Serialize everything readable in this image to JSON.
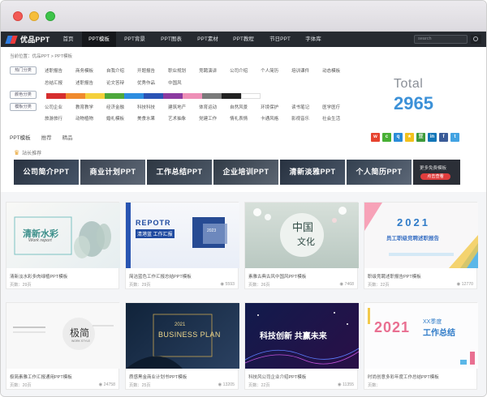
{
  "nav": {
    "logo": "优品PPT",
    "items": [
      "首页",
      "PPT模板",
      "PPT背景",
      "PPT图表",
      "PPT素材",
      "PPT教程",
      "节日PPT",
      "字体库"
    ],
    "search_placeholder": "search"
  },
  "breadcrumb": "当前位置：优品PPT > PPT模板",
  "filters": {
    "hot_label": "热门分类",
    "hot_row1": [
      "述职报告",
      "商务模板",
      "自我介绍",
      "开题报告",
      "职业规划",
      "竞聘演讲",
      "公司介绍",
      "个人简历",
      "培训课件",
      "动态模板"
    ],
    "hot_row2": [
      "总结汇报",
      "述职报告",
      "论文答辩",
      "优秀作品",
      "中国风"
    ],
    "color_label": "颜色分类",
    "colors": [
      "#d62e2e",
      "#f08a2d",
      "#f4d03b",
      "#4ea83c",
      "#2d8de0",
      "#2a53b5",
      "#8b3aa0",
      "#ee8fb7",
      "#7a7a7a",
      "#222222",
      "#ffffff"
    ],
    "template_label": "模板分类",
    "template_row1": [
      "公司企业",
      "教育教学",
      "经济金融",
      "科技科技",
      "建筑地产",
      "体育运动",
      "自然风景",
      "环境保护",
      "读书笔记",
      "医学医疗"
    ],
    "template_row2": [
      "旅游旅行",
      "动物植物",
      "婚礼模板",
      "美食水果",
      "艺术抽象",
      "党建工作",
      "情礼表情",
      "卡通风格",
      "影视音乐",
      "社会生活"
    ]
  },
  "total": {
    "label": "Total",
    "count": "2965"
  },
  "tabs": [
    "PPT模板",
    "推荐",
    "精品"
  ],
  "social_icons": [
    "weibo-icon",
    "wechat-icon",
    "qzone-icon",
    "star-icon",
    "douban-icon",
    "linkedin-icon",
    "facebook-icon",
    "twitter-icon"
  ],
  "recommend": {
    "title": "站长推荐",
    "banners": [
      "公司简介PPT",
      "商业计划PPT",
      "工作总结PPT",
      "企业培训PPT",
      "清新淡雅PPT",
      "个人简历PPT"
    ],
    "more_text": "更多免费模板",
    "more_button": "点击查看"
  },
  "cards": [
    {
      "title": "清新淡水彩多肉绿植PPT模板",
      "pages": "页数：29页",
      "views": "",
      "thumb_text": [
        "清新水彩",
        "Work report"
      ]
    },
    {
      "title": "简洁蓝色工作汇报总结PPT模板",
      "pages": "页数：29页",
      "views": "5593",
      "thumb_text": [
        "REPOTR",
        "清港蓝 工作汇报",
        "2023"
      ]
    },
    {
      "title": "素雅古典古风中国风PPT模板",
      "pages": "页数：26页",
      "views": "7468",
      "thumb_text": [
        "中国",
        "文化"
      ]
    },
    {
      "title": "职级竞聘述职报告PPT模板",
      "pages": "页数：22页",
      "views": "12770",
      "thumb_text": [
        "2021",
        "员工职级竞聘述职报告"
      ]
    },
    {
      "title": "极简素雅工作汇报通用PPT模板",
      "pages": "页数：20页",
      "views": "24758",
      "thumb_text": [
        "极简",
        "WORK STYLE"
      ]
    },
    {
      "title": "质感黑金商业计划书PPT模板",
      "pages": "页数：25页",
      "views": "13205",
      "thumb_text": [
        "2021",
        "BUSINESS PLAN"
      ]
    },
    {
      "title": "科技风公司企业介绍PPT模板",
      "pages": "页数：22页",
      "views": "11355",
      "thumb_text": [
        "科技创新 共赢未来"
      ]
    },
    {
      "title": "时尚创意多彩年度工作总结PPT模板",
      "pages": "页数：",
      "views": "",
      "thumb_text": [
        "2021",
        "XX季度",
        "工作总结"
      ]
    }
  ]
}
